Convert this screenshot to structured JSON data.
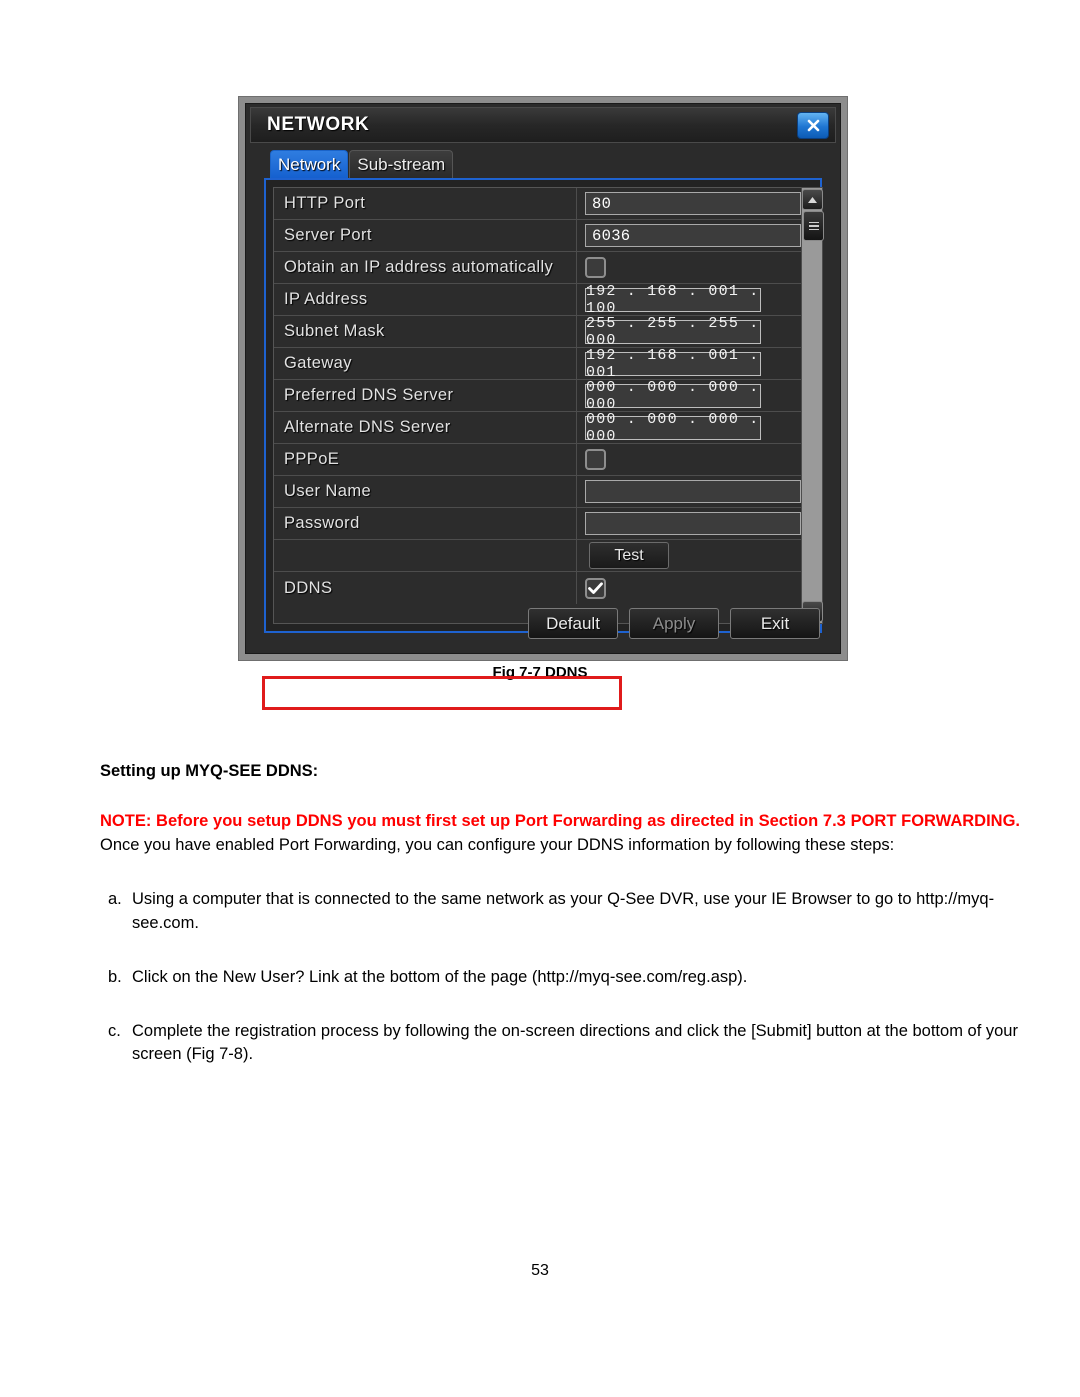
{
  "figure": {
    "caption": "Fig 7-7 DDNS",
    "dialog": {
      "title": "NETWORK",
      "close_icon": "close-icon",
      "tabs": [
        {
          "label": "Network",
          "active": true
        },
        {
          "label": "Sub-stream",
          "active": false
        }
      ],
      "rows": [
        {
          "label": "HTTP Port",
          "type": "text",
          "value": "80"
        },
        {
          "label": "Server Port",
          "type": "text",
          "value": "6036"
        },
        {
          "label": "Obtain an IP address automatically",
          "type": "checkbox",
          "checked": false
        },
        {
          "label": "IP Address",
          "type": "ip",
          "value": "192 . 168 . 001 . 100"
        },
        {
          "label": "Subnet Mask",
          "type": "ip",
          "value": "255 . 255 . 255 . 000"
        },
        {
          "label": "Gateway",
          "type": "ip",
          "value": "192 . 168 . 001 . 001"
        },
        {
          "label": "Preferred DNS Server",
          "type": "ip",
          "value": "000 . 000 . 000 . 000"
        },
        {
          "label": "Alternate DNS Server",
          "type": "ip",
          "value": "000 . 000 . 000 . 000"
        },
        {
          "label": "PPPoE",
          "type": "checkbox",
          "checked": false
        },
        {
          "label": "User Name",
          "type": "text",
          "value": ""
        },
        {
          "label": "Password",
          "type": "text",
          "value": ""
        },
        {
          "label": "",
          "type": "button",
          "value": "Test"
        },
        {
          "label": "DDNS",
          "type": "checkbox",
          "checked": true,
          "highlighted": true
        }
      ],
      "footer_buttons": [
        {
          "label": "Default",
          "disabled": false
        },
        {
          "label": "Apply",
          "disabled": true
        },
        {
          "label": "Exit",
          "disabled": false
        }
      ],
      "scrollbar": {
        "up_icon": "chevron-up-icon",
        "down_icon": "chevron-down-icon"
      },
      "colors": {
        "accent_blue": "#1e62d0",
        "highlight_red": "#e01b1b",
        "window_bg": "#2b2b2b"
      }
    }
  },
  "document": {
    "heading": "Setting up MYQ-SEE DDNS:",
    "note": {
      "red_part": "NOTE: Before you setup DDNS you must first set up Port Forwarding as directed in Section 7.3 PORT FORWARDING.",
      "rest": " Once you have enabled Port Forwarding, you can configure your DDNS information by following these steps:"
    },
    "steps": [
      {
        "marker": "a.",
        "text": "Using a computer that is connected to the same network as your Q-See DVR, use your IE Browser to go to http://myq-see.com."
      },
      {
        "marker": "b.",
        "text": "Click on the New User? Link at the bottom of the page (http://myq-see.com/reg.asp)."
      },
      {
        "marker": "c.",
        "text": "Complete the registration process by following the on-screen directions and click the [Submit] button at the bottom of your screen (Fig 7-8)."
      }
    ],
    "page_number": "53"
  }
}
